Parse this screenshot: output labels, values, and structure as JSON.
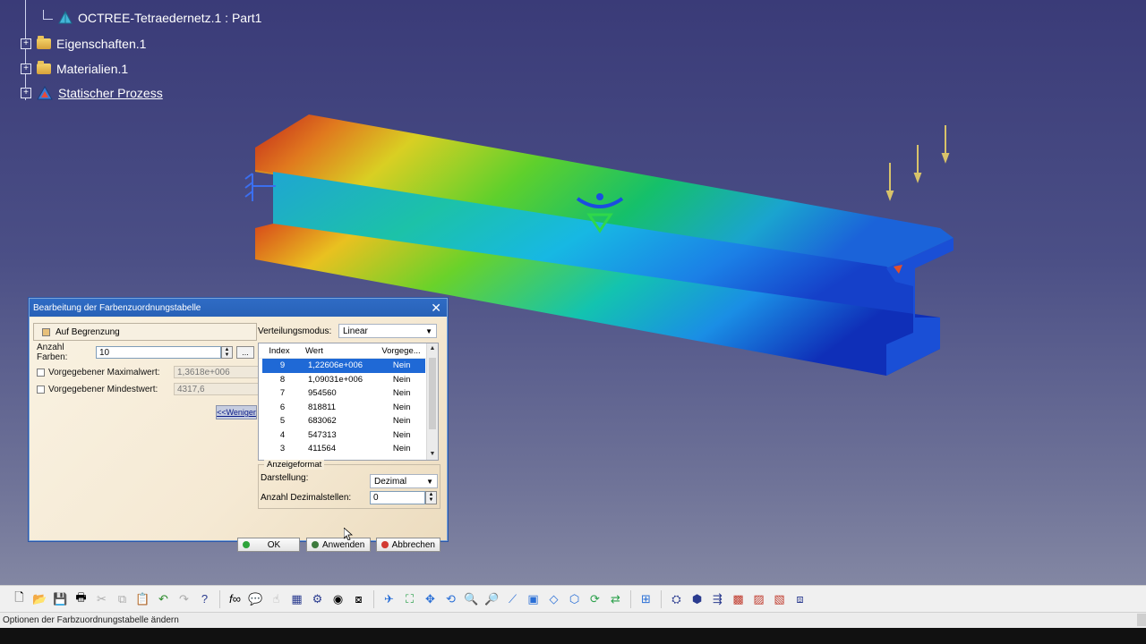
{
  "tree": {
    "items": [
      {
        "label": "OCTREE-Tetraedernetz.1 : Part1",
        "type": "mesh"
      },
      {
        "label": "Eigenschaften.1",
        "type": "folder"
      },
      {
        "label": "Materialien.1",
        "type": "folder"
      },
      {
        "label": "Statischer Prozess",
        "type": "process"
      }
    ]
  },
  "dialog": {
    "title": "Bearbeitung der Farbenzuordnungstabelle",
    "auf_begrenzung": "Auf Begrenzung",
    "anzahl_farben_label": "Anzahl Farben:",
    "anzahl_farben_value": "10",
    "ellipsis": "...",
    "max_label": "Vorgegebener Maximalwert:",
    "max_value": "1,3618e+006",
    "min_label": "Vorgegebener Mindestwert:",
    "min_value": "4317,6",
    "weniger_button": "<<Weniger",
    "verteilung_label": "Verteilungsmodus:",
    "verteilung_value": "Linear",
    "table_headers": [
      "Index",
      "Wert",
      "Vorgege..."
    ],
    "rows": [
      {
        "index": "9",
        "wert": "1,22606e+006",
        "vorgegeben": "Nein",
        "selected": true
      },
      {
        "index": "8",
        "wert": "1,09031e+006",
        "vorgegeben": "Nein"
      },
      {
        "index": "7",
        "wert": "954560",
        "vorgegeben": "Nein"
      },
      {
        "index": "6",
        "wert": "818811",
        "vorgegeben": "Nein"
      },
      {
        "index": "5",
        "wert": "683062",
        "vorgegeben": "Nein"
      },
      {
        "index": "4",
        "wert": "547313",
        "vorgegeben": "Nein"
      },
      {
        "index": "3",
        "wert": "411564",
        "vorgegeben": "Nein"
      }
    ],
    "anzeigeformat_legend": "Anzeigeformat",
    "darstellung_label": "Darstellung:",
    "darstellung_value": "Dezimal",
    "dezimal_label": "Anzahl Dezimalstellen:",
    "dezimal_value": "0",
    "ok_button": "OK",
    "anwenden_button": "Anwenden",
    "abbrechen_button": "Abbrechen"
  },
  "status_text": "Optionen der Farbzuordnungstabelle ändern"
}
